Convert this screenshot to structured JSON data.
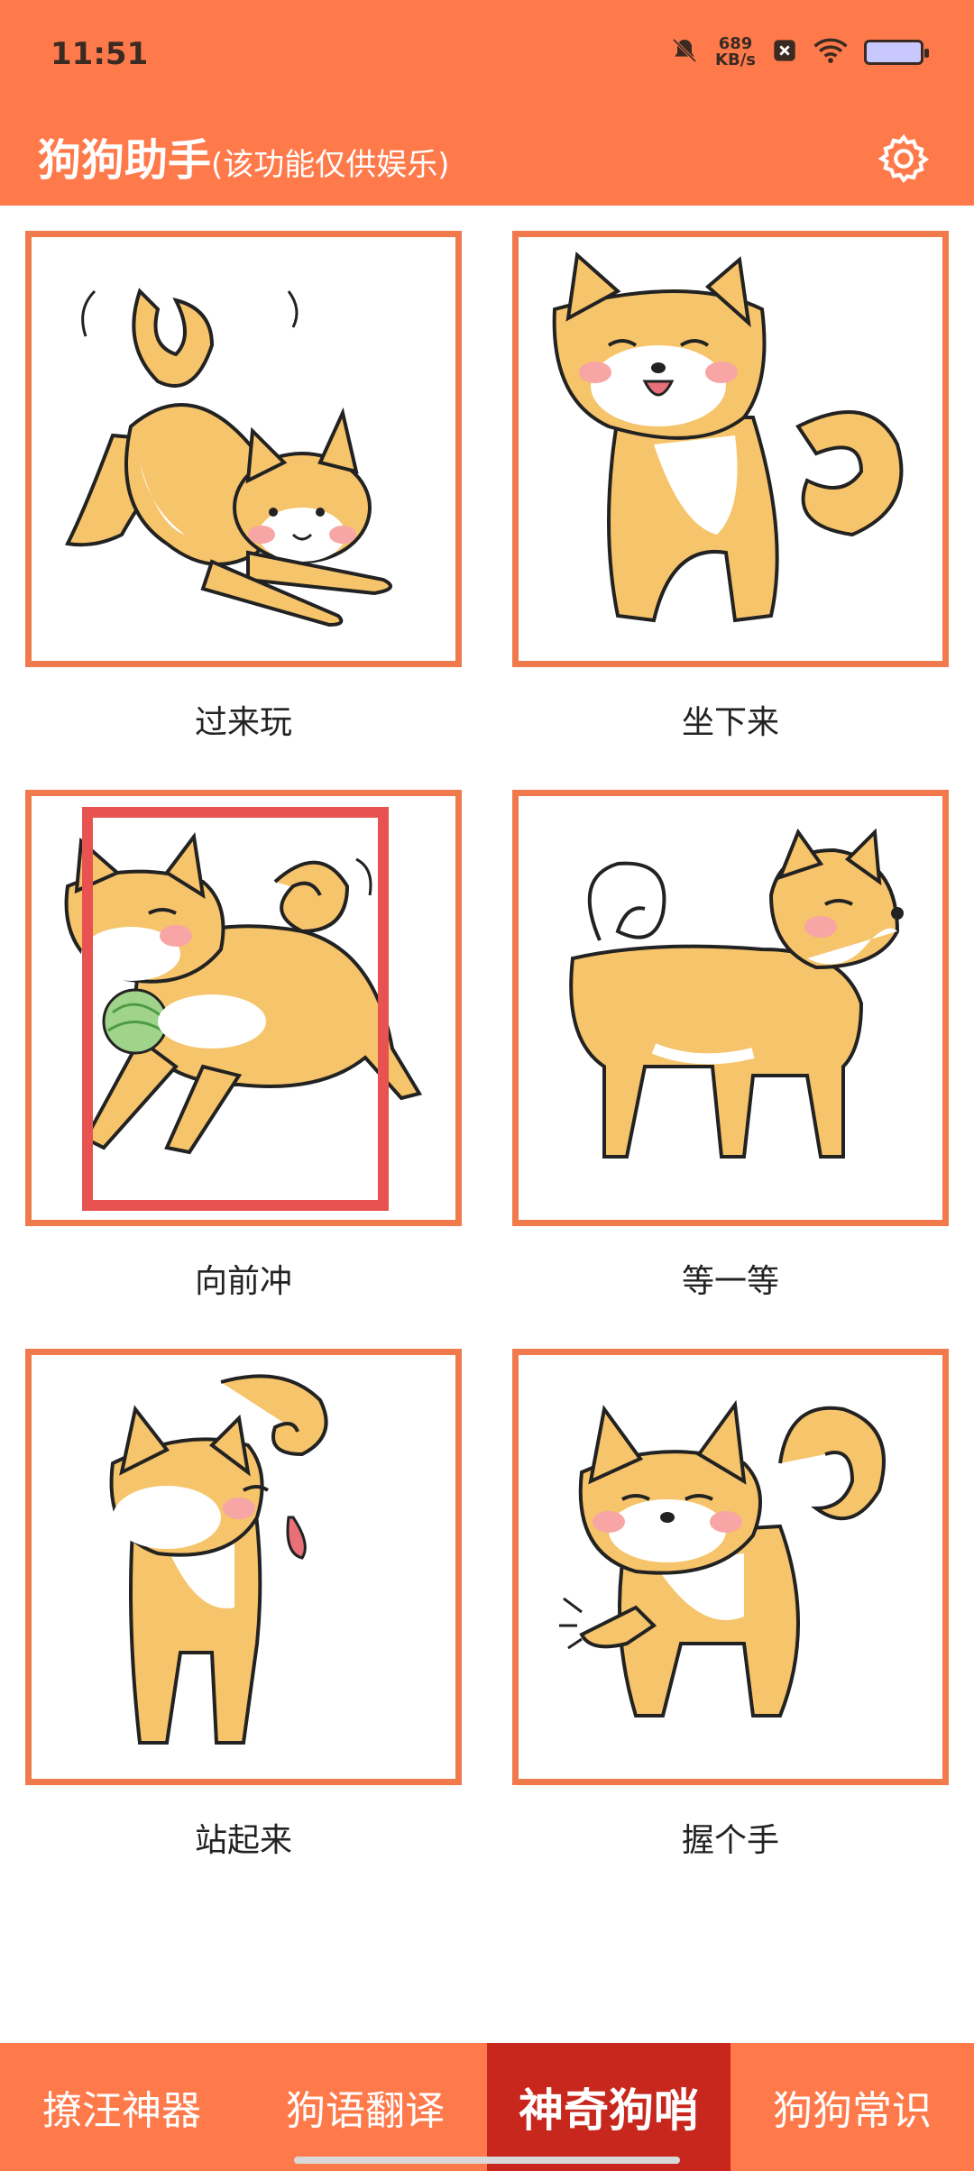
{
  "status": {
    "time": "11:51",
    "net_speed_value": "689",
    "net_speed_unit": "KB/s"
  },
  "app": {
    "title": "狗狗助手",
    "subtitle": "(该功能仅供娱乐)"
  },
  "commands": [
    {
      "label": "过来玩"
    },
    {
      "label": "坐下来"
    },
    {
      "label": "向前冲"
    },
    {
      "label": "等一等"
    },
    {
      "label": "站起来"
    },
    {
      "label": "握个手"
    }
  ],
  "tabs": [
    {
      "label": "撩汪神器"
    },
    {
      "label": "狗语翻译"
    },
    {
      "label": "神奇狗哨",
      "active": true
    },
    {
      "label": "狗狗常识"
    }
  ],
  "colors": {
    "primary": "#ff7a4b",
    "active_tab": "#c8271d",
    "card_border": "#f07a4c",
    "highlight": "#e85250",
    "dog_fur": "#f6c46a"
  }
}
